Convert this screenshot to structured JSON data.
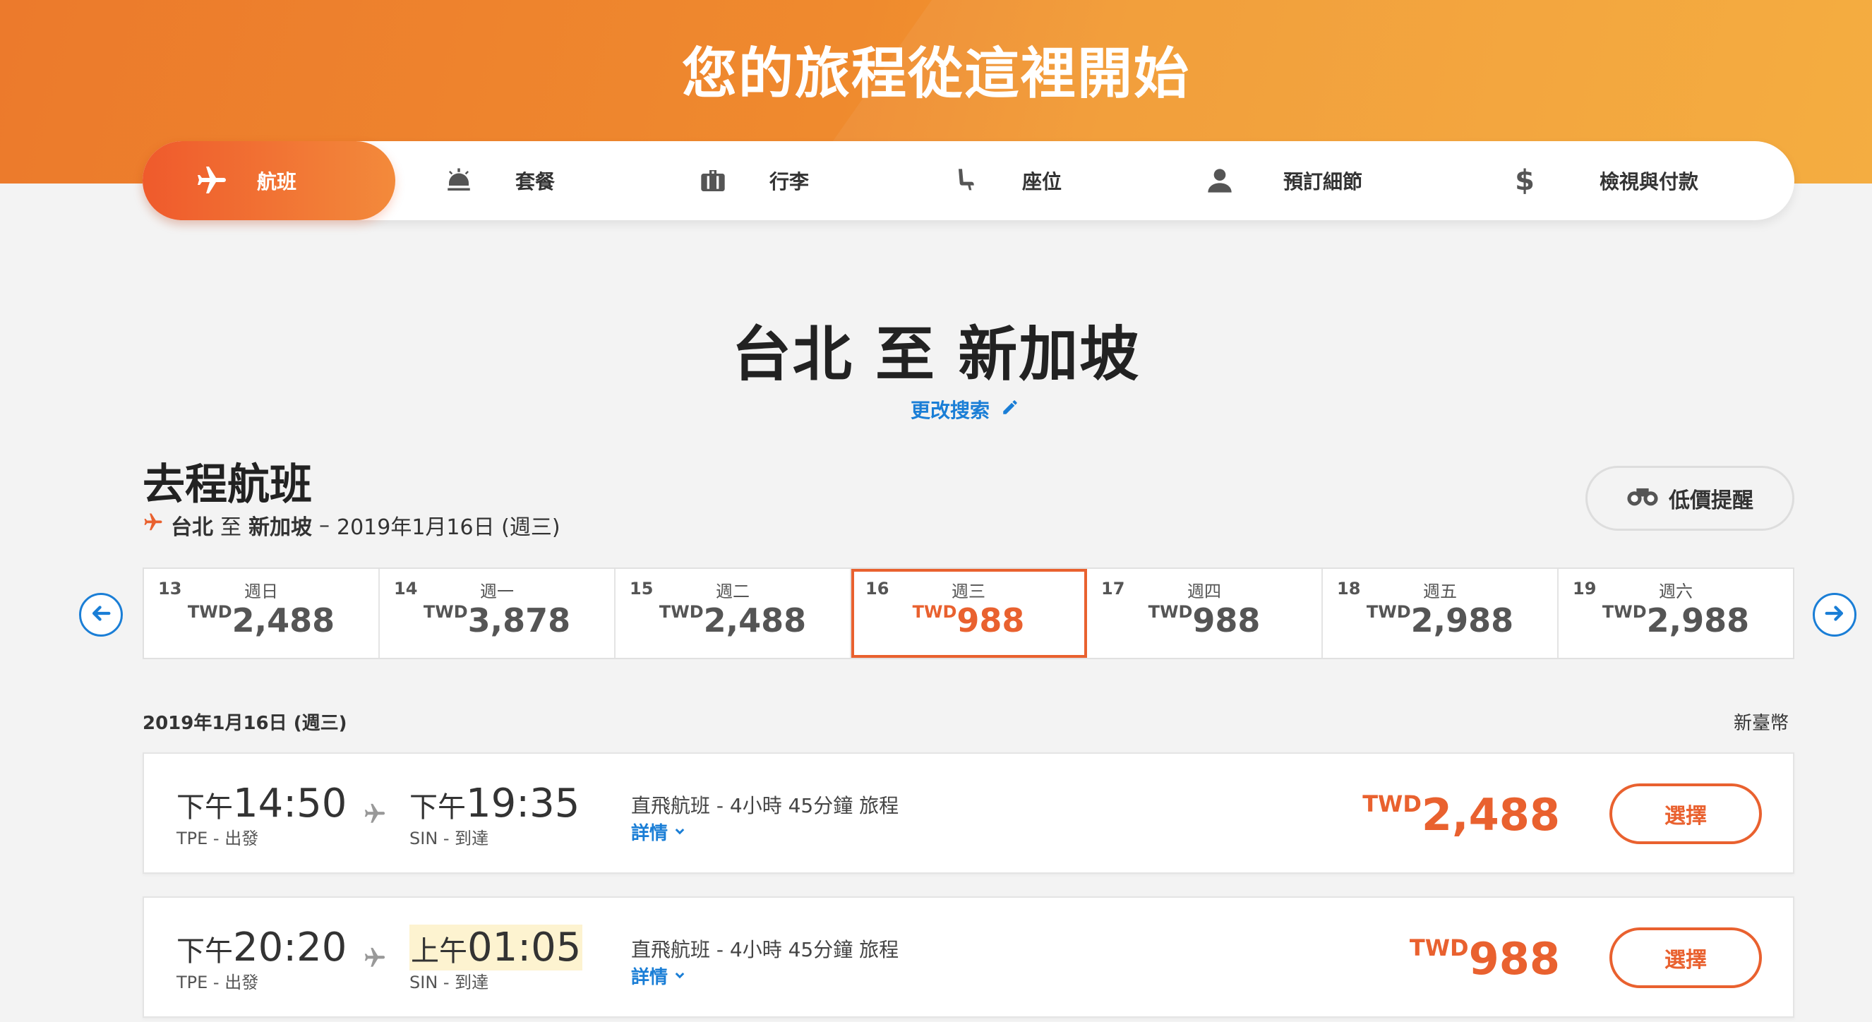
{
  "banner": {
    "title": "您的旅程從這裡開始"
  },
  "steps": [
    {
      "label": "航班",
      "icon": "plane-icon",
      "active": true
    },
    {
      "label": "套餐",
      "icon": "service-bell-icon"
    },
    {
      "label": "行李",
      "icon": "luggage-icon"
    },
    {
      "label": "座位",
      "icon": "seat-icon"
    },
    {
      "label": "預訂細節",
      "icon": "person-icon"
    },
    {
      "label": "檢視與付款",
      "icon": "dollar-icon"
    }
  ],
  "route": {
    "title": "台北 至 新加坡",
    "change_search": "更改搜索"
  },
  "outbound": {
    "title": "去程航班",
    "from": "台北",
    "to_word": "至",
    "to": "新加坡",
    "dash": "–",
    "date": "2019年1月16日 (週三)",
    "alert_label": "低價提醒"
  },
  "dates": [
    {
      "day": "13",
      "weekday": "週日",
      "currency": "TWD",
      "price": "2,488"
    },
    {
      "day": "14",
      "weekday": "週一",
      "currency": "TWD",
      "price": "3,878"
    },
    {
      "day": "15",
      "weekday": "週二",
      "currency": "TWD",
      "price": "2,488"
    },
    {
      "day": "16",
      "weekday": "週三",
      "currency": "TWD",
      "price": "988"
    },
    {
      "day": "17",
      "weekday": "週四",
      "currency": "TWD",
      "price": "988"
    },
    {
      "day": "18",
      "weekday": "週五",
      "currency": "TWD",
      "price": "2,988"
    },
    {
      "day": "19",
      "weekday": "週六",
      "currency": "TWD",
      "price": "2,988"
    }
  ],
  "list": {
    "date": "2019年1月16日 (週三)",
    "currency_label": "新臺幣"
  },
  "flights": [
    {
      "dep_ampm": "下午",
      "dep_time": "14:50",
      "dep_code": "TPE - 出發",
      "arr_ampm": "下午",
      "arr_time": "19:35",
      "arr_code": "SIN - 到達",
      "info": "直飛航班 - 4小時 45分鐘 旅程",
      "detail": "詳情",
      "currency": "TWD",
      "price": "2,488",
      "select": "選擇"
    },
    {
      "dep_ampm": "下午",
      "dep_time": "20:20",
      "dep_code": "TPE - 出發",
      "arr_ampm": "上午",
      "arr_time": "01:05",
      "arr_code": "SIN - 到達",
      "info": "直飛航班 - 4小時 45分鐘 旅程",
      "detail": "詳情",
      "currency": "TWD",
      "price": "988",
      "select": "選擇"
    }
  ]
}
